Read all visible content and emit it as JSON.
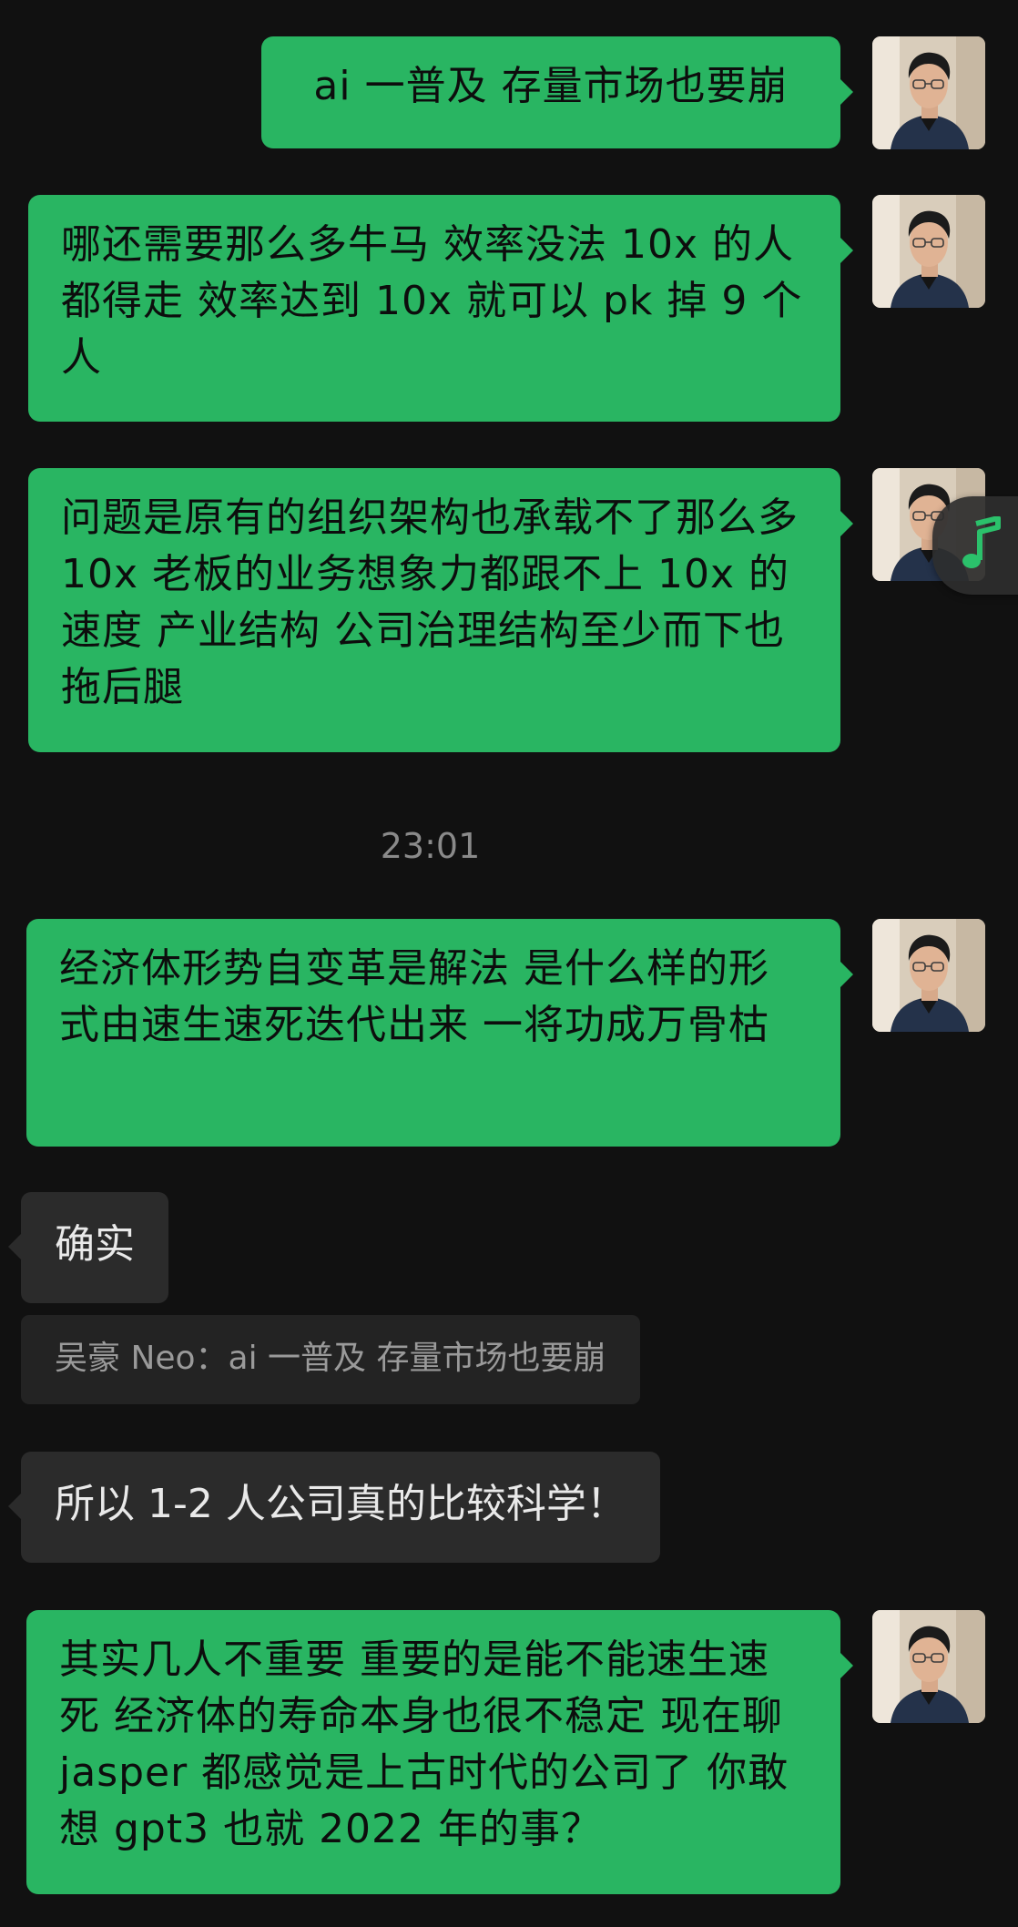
{
  "theme": {
    "background": "#111111",
    "outgoing_bubble": "#29b562",
    "incoming_bubble": "#2b2b2b",
    "quote_bubble": "#232323",
    "timestamp_color": "#8a8a8a",
    "music_accent": "#2bc16b"
  },
  "messages": [
    {
      "sender": "self",
      "text": "ai 一普及 存量市场也要崩"
    },
    {
      "sender": "self",
      "text": "哪还需要那么多牛马 效率没法 10x 的人都得走 效率达到 10x 就可以 pk 掉 9 个人"
    },
    {
      "sender": "self",
      "text": "问题是原有的组织架构也承载不了那么多 10x 老板的业务想象力都跟不上 10x 的速度 产业结构 公司治理结构至少而下也拖后腿"
    },
    {
      "timestamp": "23:01"
    },
    {
      "sender": "self",
      "text": "经济体形势自变革是解法 是什么样的形式由速生速死迭代出来 一将功成万骨枯"
    },
    {
      "sender": "other",
      "text": "确实"
    },
    {
      "quote": "吴豪 Neo：ai 一普及 存量市场也要崩"
    },
    {
      "sender": "other",
      "text": "所以 1-2 人公司真的比较科学！"
    },
    {
      "sender": "self",
      "text": "其实几人不重要 重要的是能不能速生速死 经济体的寿命本身也很不稳定 现在聊 jasper 都感觉是上古时代的公司了 你敢想 gpt3 也就 2022 年的事？"
    }
  ],
  "floating_widget": {
    "icon": "music-note-icon"
  }
}
